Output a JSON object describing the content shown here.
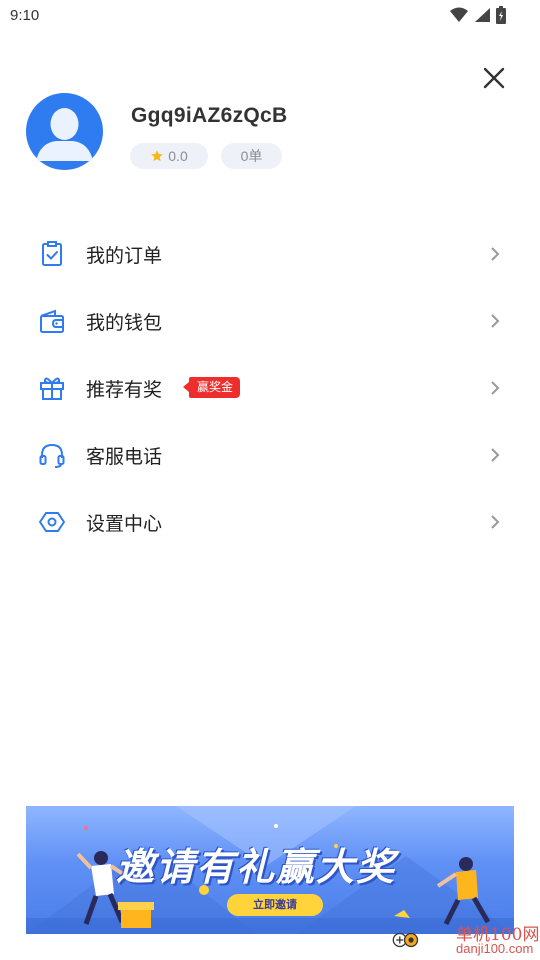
{
  "status_bar": {
    "time": "9:10",
    "icons": [
      "wifi-icon",
      "signal-icon",
      "battery-icon"
    ]
  },
  "header": {
    "close_icon": "close-icon"
  },
  "profile": {
    "avatar_icon": "user-avatar-icon",
    "username": "Ggq9iAZ6zQcB",
    "rating": "0.0",
    "orders": "0单"
  },
  "menu": {
    "items": [
      {
        "label": "我的订单",
        "icon": "order-clipboard-icon"
      },
      {
        "label": "我的钱包",
        "icon": "wallet-icon"
      },
      {
        "label": "推荐有奖",
        "icon": "gift-icon",
        "badge": "赢奖金"
      },
      {
        "label": "客服电话",
        "icon": "headset-icon"
      },
      {
        "label": "设置中心",
        "icon": "settings-hexagon-icon"
      }
    ]
  },
  "banner": {
    "title": "邀请有礼赢大奖",
    "button": "立即邀请"
  },
  "watermark": {
    "text": "单机100网",
    "url": "danji100.com"
  },
  "colors": {
    "accent": "#2f7bf0",
    "badge": "#ee2d2d",
    "chip_bg": "#eef1f7",
    "banner_button": "#ffd43a"
  }
}
